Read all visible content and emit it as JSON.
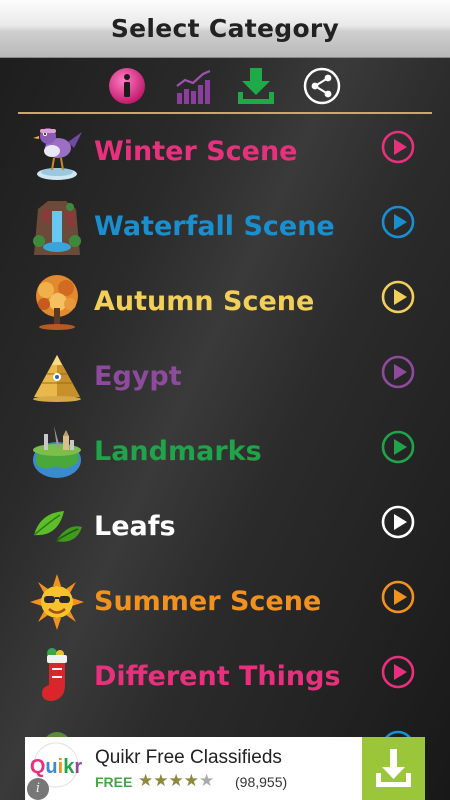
{
  "header": {
    "title": "Select Category"
  },
  "toolbar": {
    "items": [
      {
        "icon": "info-icon",
        "color": "#e0338a"
      },
      {
        "icon": "stats-chart-icon",
        "color": "#8a3f9a"
      },
      {
        "icon": "download-icon",
        "color": "#1faa4a"
      },
      {
        "icon": "share-icon",
        "color": "#ffffff"
      }
    ],
    "divider_color": "#c9a96a"
  },
  "categories": [
    {
      "label": "Winter Scene",
      "color": "#e8317e",
      "thumb": "bird-on-ice-icon"
    },
    {
      "label": "Waterfall Scene",
      "color": "#1a8fd0",
      "thumb": "waterfall-icon"
    },
    {
      "label": "Autumn Scene",
      "color": "#f2cf58",
      "thumb": "autumn-tree-icon"
    },
    {
      "label": "Egypt",
      "color": "#8e4b9e",
      "thumb": "pyramid-icon"
    },
    {
      "label": "Landmarks",
      "color": "#1fa44a",
      "thumb": "globe-landmarks-icon"
    },
    {
      "label": "Leafs",
      "color": "#ffffff",
      "thumb": "leaves-icon"
    },
    {
      "label": "Summer Scene",
      "color": "#f2921e",
      "thumb": "sun-icon"
    },
    {
      "label": "Different Things",
      "color": "#e8317e",
      "thumb": "stocking-icon"
    }
  ],
  "ad": {
    "brand": "Quikr",
    "app_name": "Quikr Free Classifieds",
    "price": "FREE",
    "rating": 4,
    "rating_max": 5,
    "reviews": "(98,955)",
    "download_icon": "download-arrow-icon",
    "accent": "#9bc63a"
  }
}
